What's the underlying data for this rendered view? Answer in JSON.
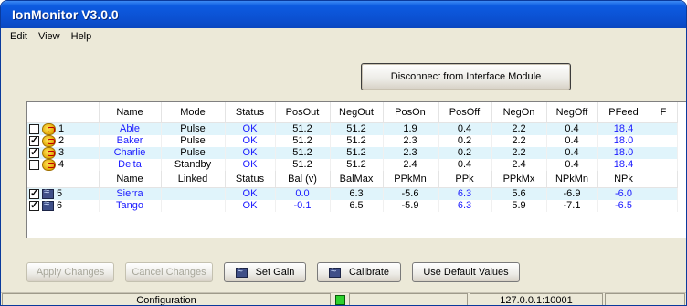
{
  "window": {
    "title": "IonMonitor V3.0.0"
  },
  "menu": {
    "items": [
      "Edit",
      "View",
      "Help"
    ]
  },
  "toolbar": {
    "disconnect_label": "Disconnect from Interface Module"
  },
  "grid": {
    "headers1": [
      "",
      "Name",
      "Mode",
      "Status",
      "PosOut",
      "NegOut",
      "PosOn",
      "PosOff",
      "NegOn",
      "NegOff",
      "PFeed",
      "F"
    ],
    "rows1": [
      {
        "checked": false,
        "num": "1",
        "name": "Able",
        "mode": "Pulse",
        "status": "OK",
        "posout": "51.2",
        "negout": "51.2",
        "poson": "1.9",
        "posoff": "0.4",
        "negon": "2.2",
        "negoff": "0.4",
        "pfeed": "18.4"
      },
      {
        "checked": true,
        "num": "2",
        "name": "Baker",
        "mode": "Pulse",
        "status": "OK",
        "posout": "51.2",
        "negout": "51.2",
        "poson": "2.3",
        "posoff": "0.2",
        "negon": "2.2",
        "negoff": "0.4",
        "pfeed": "18.0"
      },
      {
        "checked": true,
        "num": "3",
        "name": "Charlie",
        "mode": "Pulse",
        "status": "OK",
        "posout": "51.2",
        "negout": "51.2",
        "poson": "2.3",
        "posoff": "0.2",
        "negon": "2.2",
        "negoff": "0.4",
        "pfeed": "18.0"
      },
      {
        "checked": false,
        "num": "4",
        "name": "Delta",
        "mode": "Standby",
        "status": "OK",
        "posout": "51.2",
        "negout": "51.2",
        "poson": "2.4",
        "posoff": "0.4",
        "negon": "2.4",
        "negoff": "0.4",
        "pfeed": "18.4"
      }
    ],
    "headers2": [
      "",
      "Name",
      "Linked",
      "Status",
      "Bal (v)",
      "BalMax",
      "PPkMn",
      "PPk",
      "PPkMx",
      "NPkMn",
      "NPk",
      ""
    ],
    "rows2": [
      {
        "checked": true,
        "num": "5",
        "name": "Sierra",
        "linked": "",
        "status": "OK",
        "bal": "0.0",
        "balmax": "6.3",
        "ppkmn": "-5.6",
        "ppk": "6.3",
        "ppkmx": "5.6",
        "npkmn": "-6.9",
        "npk": "-6.0"
      },
      {
        "checked": true,
        "num": "6",
        "name": "Tango",
        "linked": "",
        "status": "OK",
        "bal": "-0.1",
        "balmax": "6.5",
        "ppkmn": "-5.9",
        "ppk": "6.3",
        "ppkmx": "5.9",
        "npkmn": "-7.1",
        "npk": "-6.5"
      }
    ]
  },
  "buttons": {
    "apply": "Apply Changes",
    "cancel": "Cancel Changes",
    "set_gain": "Set Gain",
    "calibrate": "Calibrate",
    "defaults": "Use Default Values"
  },
  "status": {
    "left": "Configuration",
    "address": "127.0.0.1:10001",
    "led_color": "#2ed12e"
  },
  "colors": {
    "title_bar": "#0b4fd0",
    "value_blue": "#1a1aff",
    "row_highlight": "#e0f4fb"
  }
}
